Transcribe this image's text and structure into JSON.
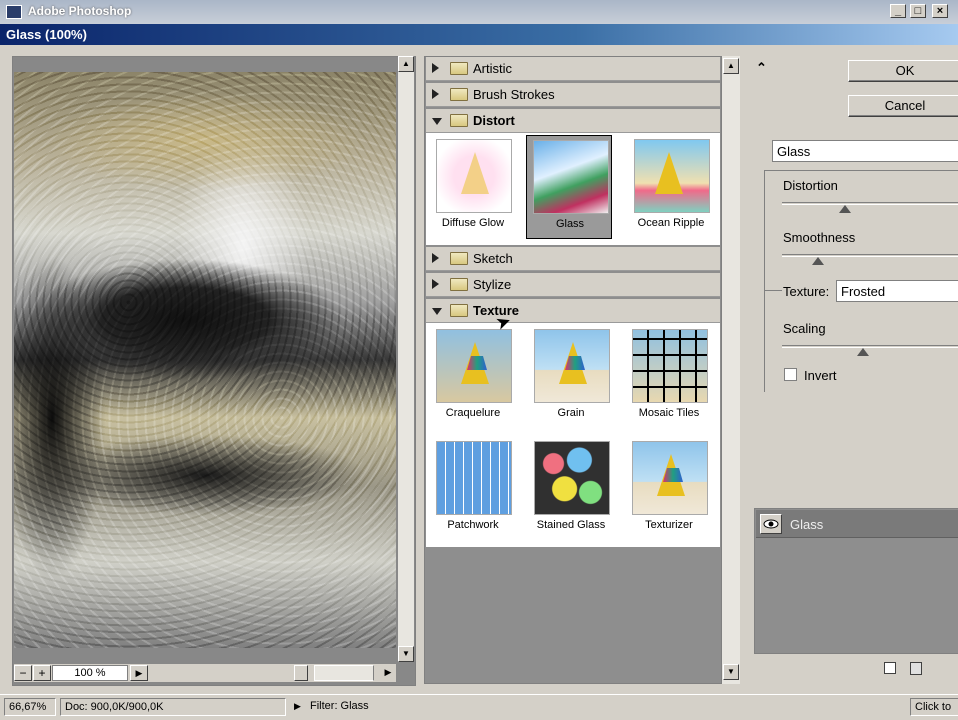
{
  "app": {
    "title": "Adobe Photoshop",
    "min": "_",
    "max": "□",
    "close": "×"
  },
  "dialog": {
    "title": "Glass (100%)"
  },
  "preview": {
    "zoom": "100 %",
    "zoom_minus": "−",
    "zoom_plus": "+"
  },
  "categories": [
    {
      "label": "Artistic",
      "open": false
    },
    {
      "label": "Brush Strokes",
      "open": false
    },
    {
      "label": "Distort",
      "open": true
    },
    {
      "label": "Sketch",
      "open": false
    },
    {
      "label": "Stylize",
      "open": false
    },
    {
      "label": "Texture",
      "open": true
    }
  ],
  "distort_filters": [
    "Diffuse Glow",
    "Glass",
    "Ocean Ripple"
  ],
  "texture_filters": [
    "Craquelure",
    "Grain",
    "Mosaic Tiles",
    "Patchwork",
    "Stained Glass",
    "Texturizer"
  ],
  "selected_filter": "Glass",
  "buttons": {
    "ok": "OK",
    "cancel": "Cancel",
    "collapse": "⌃"
  },
  "settings": {
    "filter_select": "Glass",
    "distortion_label": "Distortion",
    "smoothness_label": "Smoothness",
    "texture_label": "Texture:",
    "texture_value": "Frosted",
    "scaling_label": "Scaling",
    "invert_label": "Invert",
    "distortion_level": 0.35,
    "smoothness_level": 0.2,
    "scaling_level": 0.45
  },
  "effect_layers": [
    {
      "name": "Glass"
    }
  ],
  "status": {
    "zoom": "66,67%",
    "doc": "Doc: 900,0K/900,0K",
    "filter": "Filter: Glass",
    "hint": "Click to"
  }
}
